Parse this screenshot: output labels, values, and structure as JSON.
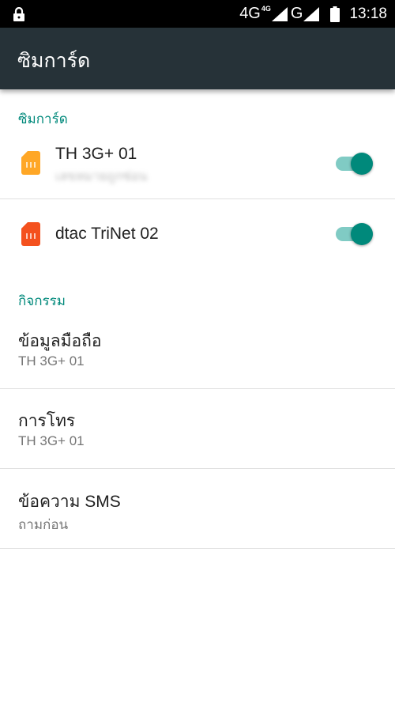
{
  "status_bar": {
    "network_1": "4G",
    "network_1_badge": "4G",
    "network_2": "G",
    "time": "13:18"
  },
  "app_bar": {
    "title": "ซิมการ์ด"
  },
  "sim_section": {
    "header": "ซิมการ์ด",
    "sims": [
      {
        "name": "TH 3G+ 01",
        "subtitle": "เลขหมายถูกซ่อน",
        "icon": "sim-card-icon",
        "icon_color": "#ffa726",
        "enabled": true
      },
      {
        "name": "dtac TriNet 02",
        "icon": "sim-card-icon",
        "icon_color": "#f4511e",
        "enabled": true
      }
    ]
  },
  "activity_section": {
    "header": "กิจกรรม",
    "items": [
      {
        "title": "ข้อมูลมือถือ",
        "value": "TH 3G+ 01"
      },
      {
        "title": "การโทร",
        "value": "TH 3G+ 01"
      },
      {
        "title": "ข้อความ SMS",
        "value": "ถามก่อน"
      }
    ]
  },
  "colors": {
    "accent": "#00897b",
    "toolbar": "#263238",
    "toggle_track": "#80cbc4"
  }
}
